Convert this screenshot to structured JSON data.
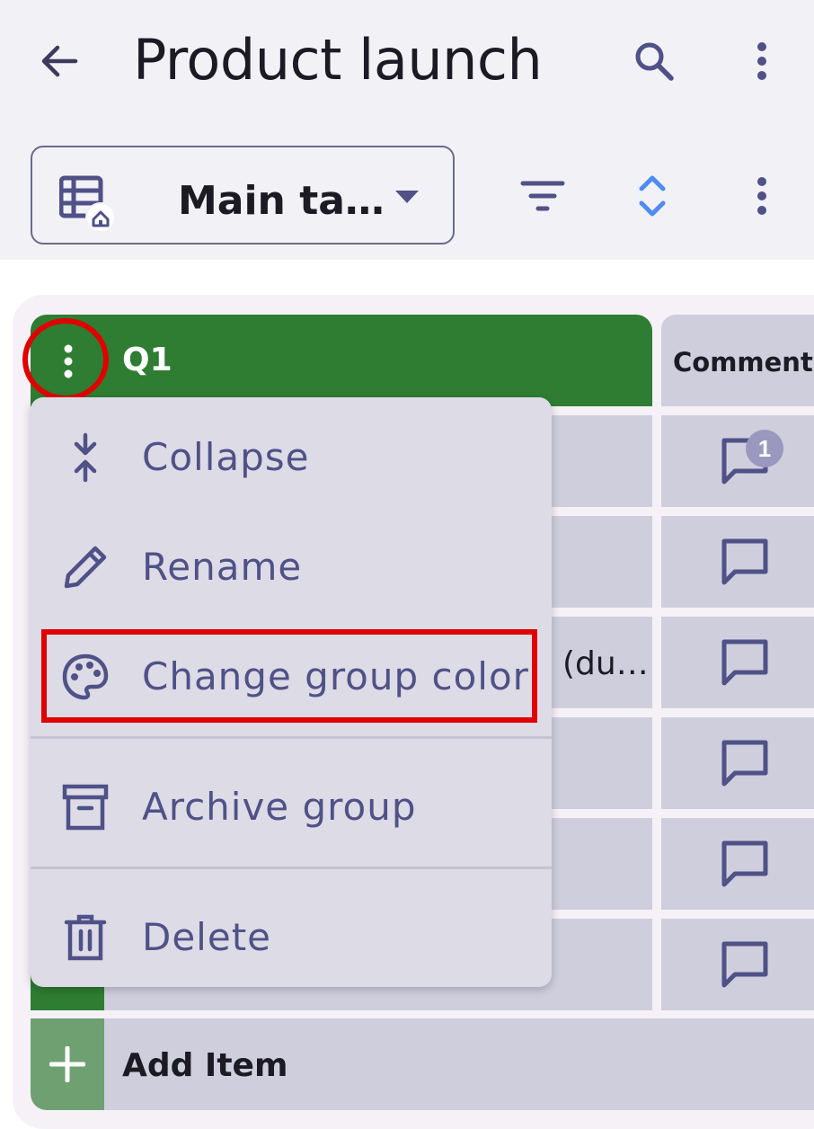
{
  "header": {
    "title": "Product launch",
    "back_icon": "arrow-back-icon",
    "search_icon": "search-icon",
    "more_icon": "more-vert-icon"
  },
  "toolbar": {
    "view_name": "Main ta…",
    "view_icon": "table-home-icon",
    "caret_icon": "dropdown-caret-icon",
    "filter_icon": "filter-icon",
    "sort_icon": "unfold-icon",
    "more_icon": "more-vert-icon"
  },
  "group": {
    "title": "Q1",
    "color": "#2e7d32",
    "menu_icon": "more-vert-icon"
  },
  "columns": {
    "comments_header": "Comments"
  },
  "rows": [
    {
      "text": "",
      "comment_count": "1"
    },
    {
      "text": "",
      "comment_count": ""
    },
    {
      "text": "(du…",
      "comment_count": ""
    },
    {
      "text": "",
      "comment_count": ""
    },
    {
      "text": "",
      "comment_count": ""
    },
    {
      "text": "",
      "comment_count": ""
    }
  ],
  "add_item": {
    "label": "Add Item",
    "icon": "plus-icon"
  },
  "menu": {
    "items": [
      {
        "label": "Collapse",
        "icon": "collapse-icon"
      },
      {
        "label": "Rename",
        "icon": "pencil-icon"
      },
      {
        "label": "Change group color",
        "icon": "palette-icon"
      },
      {
        "label": "Archive group",
        "icon": "archive-icon"
      },
      {
        "label": "Delete",
        "icon": "trash-icon"
      }
    ]
  },
  "colors": {
    "accent": "#2e7d32",
    "highlight": "#e00000",
    "menu_text": "#4f5187"
  }
}
